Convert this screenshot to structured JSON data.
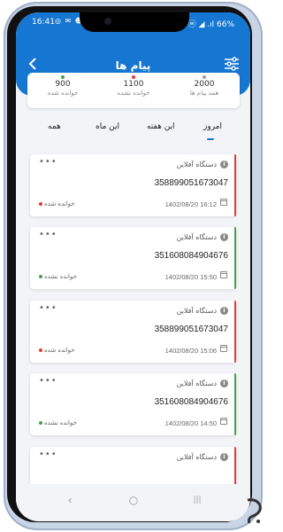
{
  "status_bar": {
    "time": "16:41",
    "left_icons": "◎ ✉ ☻ ▣",
    "right_text": "ⓦ ◢ .ıl 66%"
  },
  "header": {
    "title": "پیام ها",
    "back_icon": "chevron-left-icon",
    "filter_icon": "sliders-icon"
  },
  "stats": [
    {
      "value": "2000",
      "label": "همه پیام ها",
      "dot_color": "#9e9e9e"
    },
    {
      "value": "1100",
      "label": "خوانده نشده",
      "dot_color": "#e53935"
    },
    {
      "value": "900",
      "label": "خوانده شده",
      "dot_color": "#43a047"
    }
  ],
  "tabs": [
    "امروز",
    "این هفته",
    "این ماه",
    "همه"
  ],
  "active_tab": "امروز",
  "messages": [
    {
      "device": "دستگاه آفلاین",
      "code": "358899051673047",
      "date": "1402/08/20 16:12",
      "status": "خوانده شده",
      "status_color": "#e53935",
      "bar_color": "#e53935"
    },
    {
      "device": "دستگاه آفلاین",
      "code": "351608084904676",
      "date": "1402/08/20 15:50",
      "status": "خوانده نشده",
      "status_color": "#43a047",
      "bar_color": "#43a047"
    },
    {
      "device": "دستگاه آفلاین",
      "code": "358899051673047",
      "date": "1402/08/20 15:06",
      "status": "خوانده شده",
      "status_color": "#e53935",
      "bar_color": "#e53935"
    },
    {
      "device": "دستگاه آفلاین",
      "code": "351608084904676",
      "date": "1402/08/20 14:50",
      "status": "خوانده نشده",
      "status_color": "#43a047",
      "bar_color": "#43a047"
    },
    {
      "device": "دستگاه آفلاین",
      "code": "",
      "date": "",
      "status": "",
      "status_color": "#e53935",
      "bar_color": "#e53935"
    }
  ],
  "more_label": "•••",
  "info_glyph": "i",
  "nav": {
    "back": "‹",
    "home": "○",
    "recents": "|||"
  },
  "colors": {
    "primary": "#1677d2",
    "read": "#e53935",
    "unread": "#43a047"
  }
}
